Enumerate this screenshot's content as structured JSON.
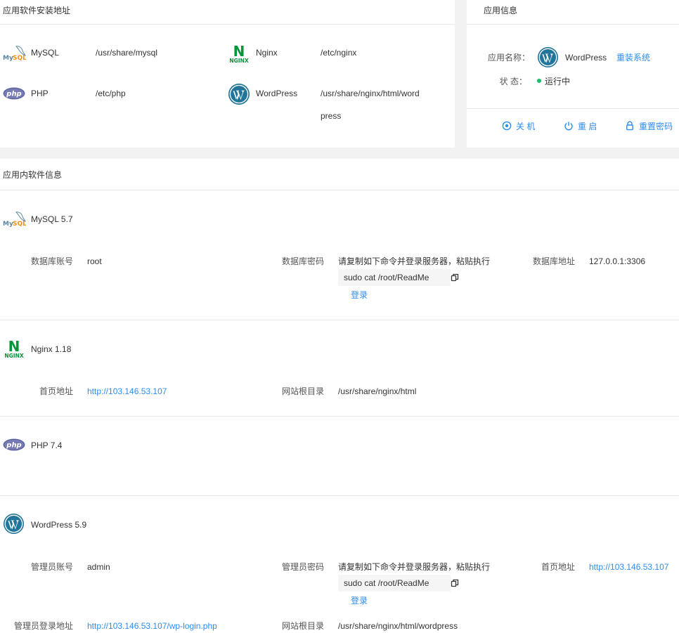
{
  "install_panel": {
    "title": "应用软件安装地址",
    "items": [
      {
        "icon": "mysql-logo-icon",
        "name": "MySQL",
        "path": "/usr/share/mysql"
      },
      {
        "icon": "nginx-logo-icon",
        "name": "Nginx",
        "path": "/etc/nginx"
      },
      {
        "icon": "php-logo-icon",
        "name": "PHP",
        "path": "/etc/php"
      },
      {
        "icon": "wordpress-logo-icon",
        "name": "WordPress",
        "path_line1": "/usr/share/nginx/html/word",
        "path_line2": "press"
      }
    ]
  },
  "app_info": {
    "title": "应用信息",
    "name_label": "应用名称：",
    "app_name": "WordPress",
    "reinstall_link": "重装系统",
    "status_label": "状 态：",
    "status_value": "运行中",
    "status_color": "#19be6b",
    "actions": [
      {
        "icon": "shutdown-icon",
        "label": "关 机"
      },
      {
        "icon": "power-icon",
        "label": "重 启"
      },
      {
        "icon": "lock-icon",
        "label": "重置密码"
      }
    ]
  },
  "software_info": {
    "title": "应用内软件信息",
    "mysql": {
      "name": "MySQL 5.7",
      "account_label": "数据库账号",
      "account_value": "root",
      "password_label": "数据库密码",
      "password_hint": "请复制如下命令并登录服务器，粘贴执行",
      "command": "sudo cat /root/ReadMe",
      "login_link": "登录",
      "address_label": "数据库地址",
      "address_value": "127.0.0.1:3306"
    },
    "nginx": {
      "name": "Nginx 1.18",
      "homepage_label": "首页地址",
      "homepage_value": "http://103.146.53.107",
      "webroot_label": "网站根目录",
      "webroot_value": "/usr/share/nginx/html"
    },
    "php": {
      "name": "PHP 7.4"
    },
    "wordpress": {
      "name": "WordPress 5.9",
      "admin_account_label": "管理员账号",
      "admin_account_value": "admin",
      "admin_password_label": "管理员密码",
      "password_hint": "请复制如下命令并登录服务器，粘贴执行",
      "command": "sudo cat /root/ReadMe",
      "login_link": "登录",
      "homepage_label": "首页地址",
      "homepage_value": "http://103.146.53.107",
      "admin_login_label": "管理员登录地址",
      "admin_login_value": "http://103.146.53.107/wp-login.php",
      "webroot_label": "网站根目录",
      "webroot_value": "/usr/share/nginx/html/wordpress"
    }
  },
  "colors": {
    "link": "#2d8cf0",
    "wordpress_blue": "#21759b",
    "nginx_green": "#009639",
    "php_purple": "#777bb3"
  }
}
